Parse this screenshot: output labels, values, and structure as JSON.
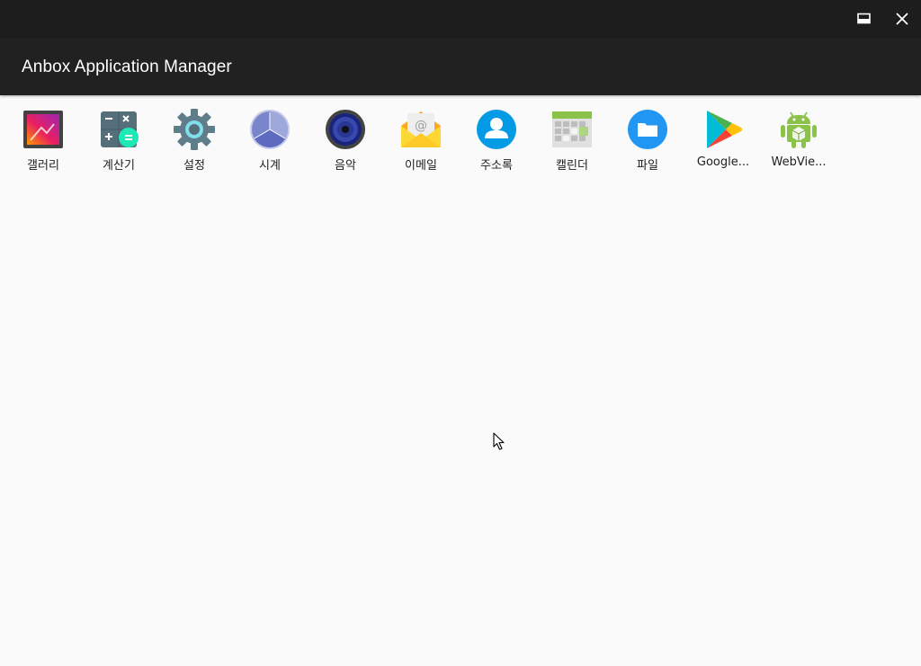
{
  "window": {
    "title": "Anbox Application Manager",
    "controls": [
      "restore-icon",
      "close-icon"
    ]
  },
  "apps": [
    {
      "label": "갤러리",
      "icon": "gallery-icon"
    },
    {
      "label": "계산기",
      "icon": "calculator-icon"
    },
    {
      "label": "설정",
      "icon": "settings-gear-icon"
    },
    {
      "label": "시계",
      "icon": "clock-icon"
    },
    {
      "label": "음악",
      "icon": "music-speaker-icon"
    },
    {
      "label": "이메일",
      "icon": "email-icon"
    },
    {
      "label": "주소록",
      "icon": "contacts-icon"
    },
    {
      "label": "캘린더",
      "icon": "calendar-icon"
    },
    {
      "label": "파일",
      "icon": "files-folder-icon"
    },
    {
      "label": "Google...",
      "icon": "google-play-icon"
    },
    {
      "label": "WebVie...",
      "icon": "android-webview-icon"
    }
  ],
  "colors": {
    "titlebar": "#1d1d1d",
    "appbar": "#212121",
    "background": "#fafafa"
  }
}
